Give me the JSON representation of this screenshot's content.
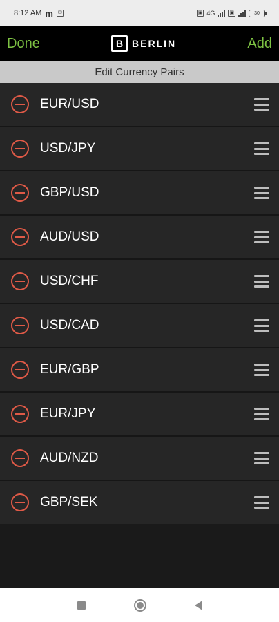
{
  "status_bar": {
    "time": "8:12 AM",
    "carrier_icons": "m",
    "right_text": "4G",
    "battery": "30"
  },
  "nav": {
    "done_label": "Done",
    "brand_mark": "B",
    "brand_name": "BERLIN",
    "add_label": "Add"
  },
  "section": {
    "title": "Edit Currency Pairs"
  },
  "pairs": [
    {
      "label": "EUR/USD"
    },
    {
      "label": "USD/JPY"
    },
    {
      "label": "GBP/USD"
    },
    {
      "label": "AUD/USD"
    },
    {
      "label": "USD/CHF"
    },
    {
      "label": "USD/CAD"
    },
    {
      "label": "EUR/GBP"
    },
    {
      "label": "EUR/JPY"
    },
    {
      "label": "AUD/NZD"
    },
    {
      "label": "GBP/SEK"
    }
  ],
  "colors": {
    "accent_green": "#7dc143",
    "remove_red": "#e05a47",
    "row_bg": "#262626",
    "header_bg": "#c9c9c9"
  }
}
